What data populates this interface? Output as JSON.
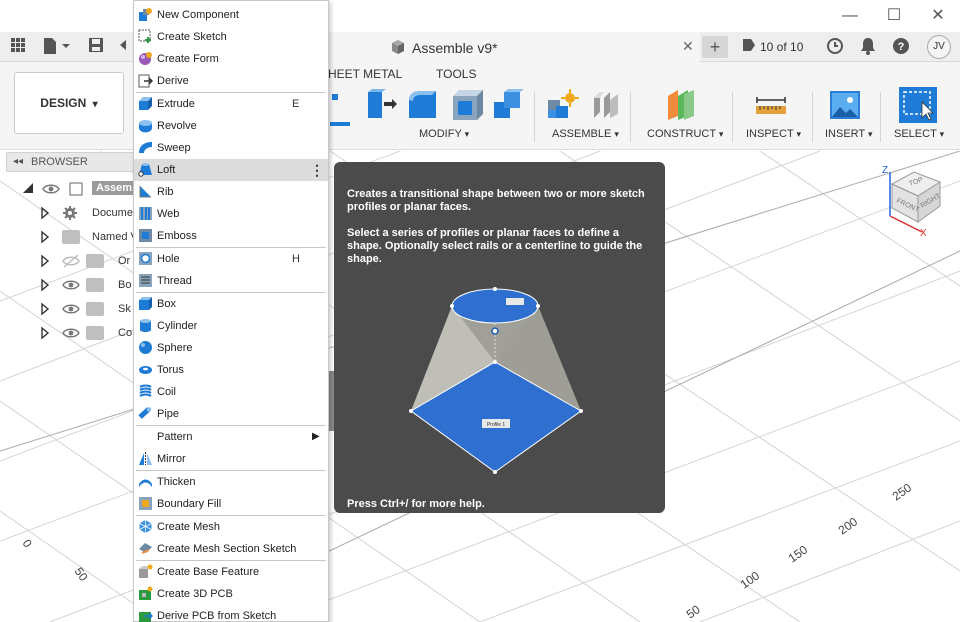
{
  "window": {
    "minimize_glyph": "—",
    "maximize_glyph": "☐",
    "close_glyph": "✕"
  },
  "tabbar": {
    "doc_title": "Assemble v9*",
    "close_glyph": "✕",
    "new_tab_glyph": "+",
    "version_text": "10 of 10",
    "avatar_initials": "JV"
  },
  "ribbon": {
    "workspace": "DESIGN",
    "tabs": [
      "HEET METAL",
      "TOOLS"
    ],
    "groups": [
      "MODIFY",
      "ASSEMBLE",
      "CONSTRUCT",
      "INSPECT",
      "INSERT",
      "SELECT"
    ],
    "dropdown_glyph": "▾"
  },
  "browser": {
    "title": "BROWSER",
    "rows": [
      {
        "label": "Assem"
      },
      {
        "label": "Docume"
      },
      {
        "label": "Named V"
      },
      {
        "label": "Or"
      },
      {
        "label": "Bo"
      },
      {
        "label": "Sk"
      },
      {
        "label": "Co"
      }
    ]
  },
  "menu": {
    "items": [
      {
        "label": "New Component",
        "icon": "new-component-icon"
      },
      {
        "label": "Create Sketch",
        "icon": "sketch-icon"
      },
      {
        "label": "Create Form",
        "icon": "form-icon"
      },
      {
        "label": "Derive",
        "icon": "derive-icon"
      },
      {
        "label": "Extrude",
        "icon": "extrude-icon",
        "shortcut": "E"
      },
      {
        "label": "Revolve",
        "icon": "revolve-icon"
      },
      {
        "label": "Sweep",
        "icon": "sweep-icon"
      },
      {
        "label": "Loft",
        "icon": "loft-icon",
        "highlighted": true
      },
      {
        "label": "Rib",
        "icon": "rib-icon"
      },
      {
        "label": "Web",
        "icon": "web-icon"
      },
      {
        "label": "Emboss",
        "icon": "emboss-icon"
      },
      {
        "label": "Hole",
        "icon": "hole-icon",
        "shortcut": "H"
      },
      {
        "label": "Thread",
        "icon": "thread-icon"
      },
      {
        "label": "Box",
        "icon": "box-icon"
      },
      {
        "label": "Cylinder",
        "icon": "cylinder-icon"
      },
      {
        "label": "Sphere",
        "icon": "sphere-icon"
      },
      {
        "label": "Torus",
        "icon": "torus-icon"
      },
      {
        "label": "Coil",
        "icon": "coil-icon"
      },
      {
        "label": "Pipe",
        "icon": "pipe-icon"
      },
      {
        "label": "Pattern",
        "icon": "",
        "submenu": true
      },
      {
        "label": "Mirror",
        "icon": "mirror-icon"
      },
      {
        "label": "Thicken",
        "icon": "thicken-icon"
      },
      {
        "label": "Boundary Fill",
        "icon": "boundary-fill-icon"
      },
      {
        "label": "Create Mesh",
        "icon": "mesh-icon"
      },
      {
        "label": "Create Mesh Section Sketch",
        "icon": "mesh-section-icon"
      },
      {
        "label": "Create Base Feature",
        "icon": "base-feature-icon"
      },
      {
        "label": "Create 3D PCB",
        "icon": "pcb-icon"
      },
      {
        "label": "Derive PCB from Sketch",
        "icon": "derive-pcb-icon"
      }
    ],
    "more_glyph": "⋮",
    "submenu_glyph": "▶"
  },
  "tooltip": {
    "summary": "Creates a transitional shape between two or more sketch profiles or planar faces.",
    "details": "Select a series of profiles or planar faces to define a shape. Optionally select rails or a centerline to guide the shape.",
    "illustration_label": "Profile 1",
    "footer": "Press Ctrl+/ for more help."
  },
  "canvas": {
    "axis_numbers": [
      "250",
      "200",
      "150",
      "100",
      "50"
    ],
    "left_numbers": [
      "50",
      "0"
    ]
  },
  "viewcube": {
    "faces": [
      "TOP",
      "FRONT",
      "RIGHT"
    ],
    "axes": [
      "Z",
      "X"
    ]
  },
  "colors": {
    "accent_blue": "#1e7bd6",
    "tooltip_bg": "#4b4b4b",
    "menu_highlight": "#dcdcdc"
  }
}
